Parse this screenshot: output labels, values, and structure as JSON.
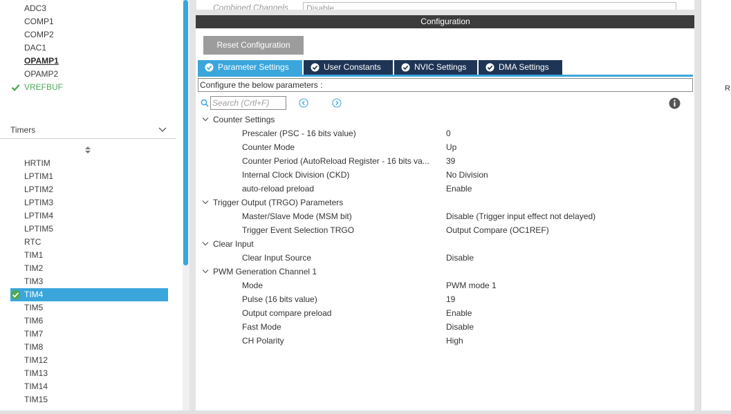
{
  "left_panel": {
    "analog_items": [
      {
        "label": "ADC3",
        "state": "normal"
      },
      {
        "label": "COMP1",
        "state": "normal"
      },
      {
        "label": "COMP2",
        "state": "normal"
      },
      {
        "label": "DAC1",
        "state": "normal"
      },
      {
        "label": "OPAMP1",
        "state": "bold"
      },
      {
        "label": "OPAMP2",
        "state": "normal"
      },
      {
        "label": "VREFBUF",
        "state": "configured"
      }
    ],
    "timers_title": "Timers",
    "timer_items": [
      {
        "label": "HRTIM",
        "state": "normal"
      },
      {
        "label": "LPTIM1",
        "state": "normal"
      },
      {
        "label": "LPTIM2",
        "state": "normal"
      },
      {
        "label": "LPTIM3",
        "state": "normal"
      },
      {
        "label": "LPTIM4",
        "state": "normal"
      },
      {
        "label": "LPTIM5",
        "state": "normal"
      },
      {
        "label": "RTC",
        "state": "normal"
      },
      {
        "label": "TIM1",
        "state": "normal"
      },
      {
        "label": "TIM2",
        "state": "normal"
      },
      {
        "label": "TIM3",
        "state": "normal"
      },
      {
        "label": "TIM4",
        "state": "selected"
      },
      {
        "label": "TIM5",
        "state": "normal"
      },
      {
        "label": "TIM6",
        "state": "normal"
      },
      {
        "label": "TIM7",
        "state": "normal"
      },
      {
        "label": "TIM8",
        "state": "normal"
      },
      {
        "label": "TIM12",
        "state": "normal"
      },
      {
        "label": "TIM13",
        "state": "normal"
      },
      {
        "label": "TIM14",
        "state": "normal"
      },
      {
        "label": "TIM15",
        "state": "normal"
      }
    ]
  },
  "top_strip": {
    "label": "Combined Channels",
    "value": "Disable"
  },
  "config": {
    "title": "Configuration",
    "reset_label": "Reset Configuration",
    "tabs": [
      {
        "label": "Parameter Settings",
        "active": true
      },
      {
        "label": "User Constants",
        "active": false
      },
      {
        "label": "NVIC Settings",
        "active": false
      },
      {
        "label": "DMA Settings",
        "active": false
      }
    ],
    "instruction": "Configure the below parameters :",
    "search_placeholder": "Search (Crtl+F)",
    "groups": [
      {
        "title": "Counter Settings",
        "params": [
          {
            "name": "Prescaler (PSC - 16 bits value)",
            "value": "0"
          },
          {
            "name": "Counter Mode",
            "value": "Up"
          },
          {
            "name": "Counter Period (AutoReload Register - 16 bits va...",
            "value": "39"
          },
          {
            "name": "Internal Clock Division (CKD)",
            "value": "No Division"
          },
          {
            "name": "auto-reload preload",
            "value": "Enable"
          }
        ]
      },
      {
        "title": "Trigger Output (TRGO) Parameters",
        "params": [
          {
            "name": "Master/Slave Mode (MSM bit)",
            "value": "Disable (Trigger input effect not delayed)"
          },
          {
            "name": "Trigger Event Selection TRGO",
            "value": "Output Compare (OC1REF)"
          }
        ]
      },
      {
        "title": "Clear Input",
        "params": [
          {
            "name": "Clear Input Source",
            "value": "Disable"
          }
        ]
      },
      {
        "title": "PWM Generation Channel 1",
        "params": [
          {
            "name": "Mode",
            "value": "PWM mode 1"
          },
          {
            "name": "Pulse (16 bits value)",
            "value": "19"
          },
          {
            "name": "Output compare preload",
            "value": "Enable"
          },
          {
            "name": "Fast Mode",
            "value": "Disable"
          },
          {
            "name": "CH Polarity",
            "value": "High"
          }
        ]
      }
    ]
  },
  "right_panel": {
    "clipped_text": "R"
  },
  "colors": {
    "accent": "#3aa6dc",
    "tab_inactive": "#1f3556",
    "configured_green": "#4fa85a",
    "header_dark": "#3c3c3c"
  }
}
